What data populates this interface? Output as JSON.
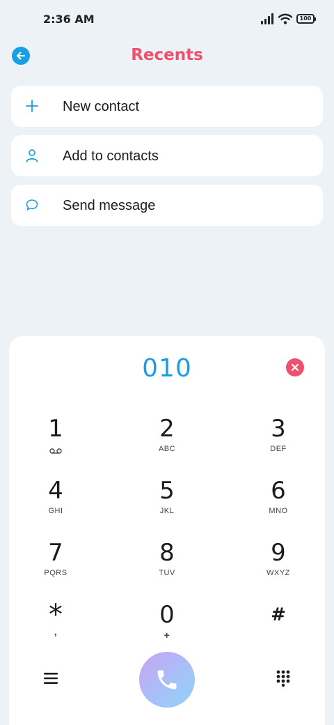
{
  "status_bar": {
    "time": "2:36 AM",
    "battery": "100"
  },
  "header": {
    "title": "Recents"
  },
  "options": [
    {
      "label": "New contact",
      "icon": "plus-icon"
    },
    {
      "label": "Add to contacts",
      "icon": "person-icon"
    },
    {
      "label": "Send message",
      "icon": "message-bubble-icon"
    }
  ],
  "dialer": {
    "number": "010",
    "keys": [
      {
        "digit": "1",
        "letters": "",
        "sub_icon": "voicemail-icon"
      },
      {
        "digit": "2",
        "letters": "ABC"
      },
      {
        "digit": "3",
        "letters": "DEF"
      },
      {
        "digit": "4",
        "letters": "GHI"
      },
      {
        "digit": "5",
        "letters": "JKL"
      },
      {
        "digit": "6",
        "letters": "MNO"
      },
      {
        "digit": "7",
        "letters": "PQRS"
      },
      {
        "digit": "8",
        "letters": "TUV"
      },
      {
        "digit": "9",
        "letters": "WXYZ"
      },
      {
        "digit": "*",
        "letters": ","
      },
      {
        "digit": "0",
        "letters": "+"
      },
      {
        "digit": "#",
        "letters": ""
      }
    ]
  },
  "colors": {
    "accent_blue": "#1a9fe3",
    "accent_red": "#f0506e",
    "background": "#ecf2f6"
  }
}
